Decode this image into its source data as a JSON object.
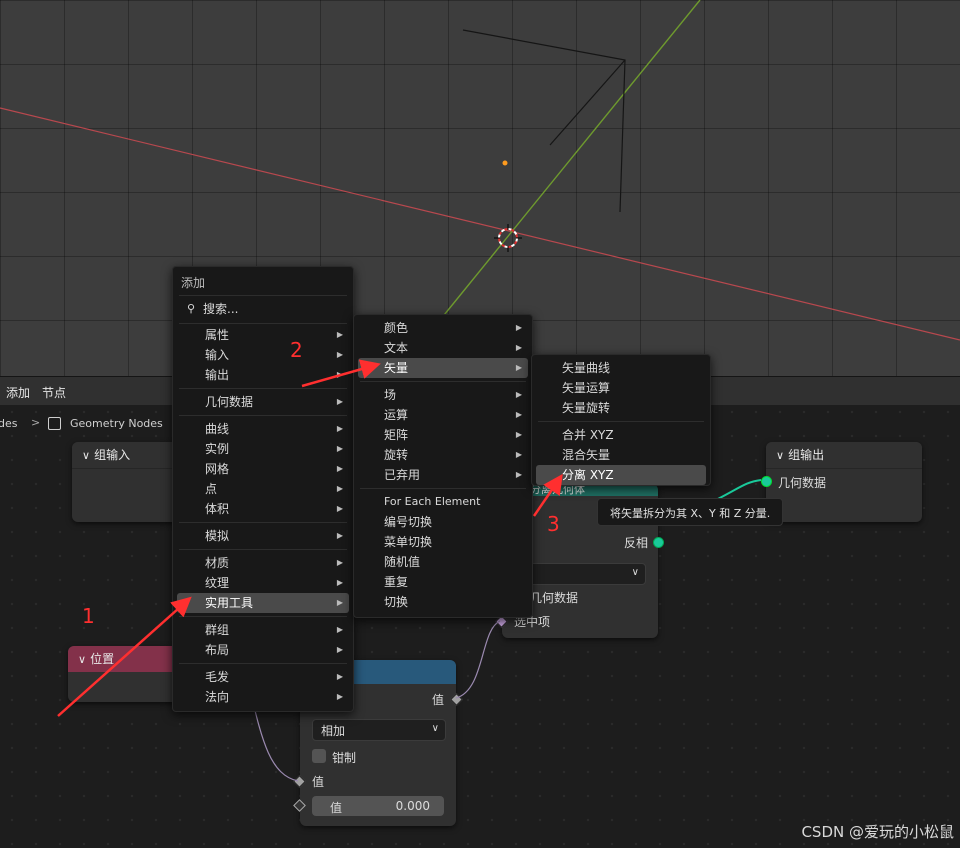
{
  "header": {
    "menu_add": "添加",
    "menu_node": "节点"
  },
  "breadcrumb": {
    "prev": "des",
    "sep": ">",
    "current": "Geometry Nodes"
  },
  "nodes": {
    "group_input": {
      "title": "组输入"
    },
    "group_output": {
      "title": "组输出",
      "socket": "几何数据"
    },
    "position": {
      "title": "位置"
    },
    "separate_geo": {
      "title": "分离几何体",
      "invert": "反相",
      "geometry": "几何数据",
      "selection": "选中项"
    },
    "math": {
      "output_label": "值",
      "operation": "相加",
      "clamp_label": "钳制",
      "input_label": "值",
      "field_label": "值",
      "field_value": "0.000"
    }
  },
  "menu_main": {
    "title": "添加",
    "search": "搜索...",
    "items": [
      "属性",
      "输入",
      "输出",
      "几何数据",
      "曲线",
      "实例",
      "网格",
      "点",
      "体积",
      "模拟",
      "材质",
      "纹理",
      "实用工具",
      "群组",
      "布局",
      "毛发",
      "法向"
    ]
  },
  "menu_utilities": {
    "items": [
      "颜色",
      "文本",
      "矢量",
      "场",
      "运算",
      "矩阵",
      "旋转",
      "已弃用",
      "For Each Element",
      "编号切换",
      "菜单切换",
      "随机值",
      "重复",
      "切换"
    ]
  },
  "menu_vector": {
    "items": [
      "矢量曲线",
      "矢量运算",
      "矢量旋转",
      "合并 XYZ",
      "混合矢量",
      "分离 XYZ"
    ]
  },
  "tooltip": "将矢量拆分为其 X、Y 和 Z 分量.",
  "annotations": [
    "1",
    "2",
    "3"
  ],
  "watermark": "CSDN @爱玩的小松鼠",
  "colors": {
    "accent_green": "#1ac99a",
    "node_position_head": "#83314a",
    "node_teal_head": "#1f6e62",
    "node_blue_head": "#28597b",
    "annotation_red": "#ff2f2f"
  }
}
